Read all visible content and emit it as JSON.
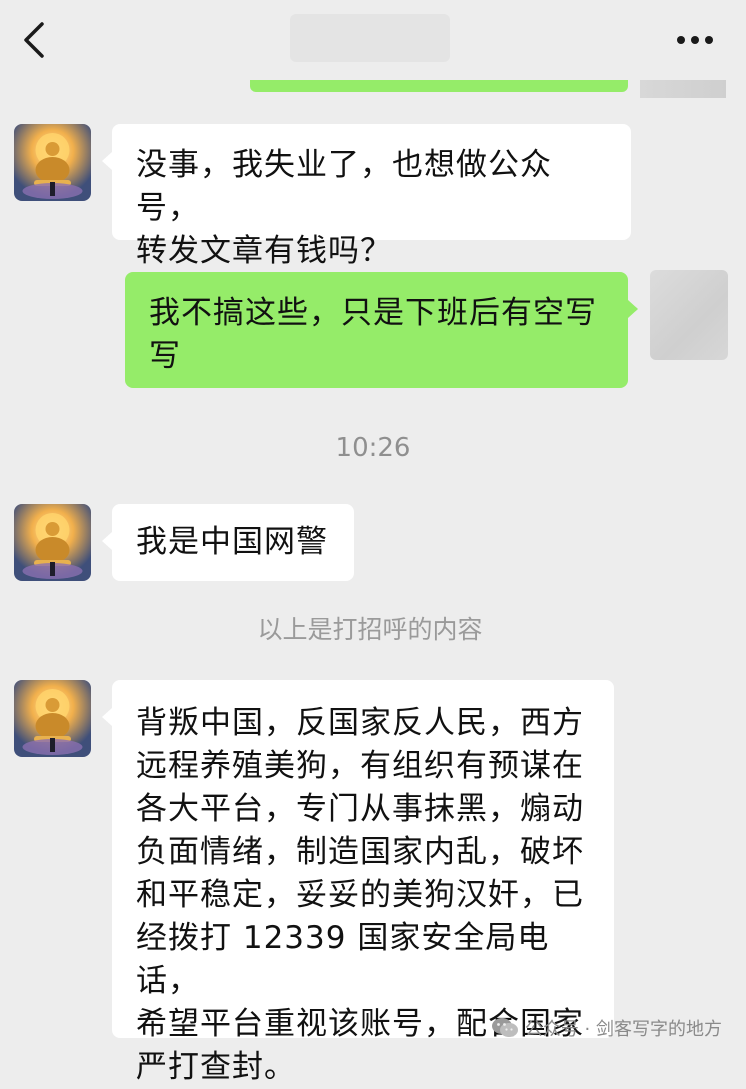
{
  "header": {
    "back_icon": "chevron-left-icon",
    "more_icon": "ellipsis-icon"
  },
  "messages": [
    {
      "side": "left",
      "text": "没事，我失业了，也想做公众号，\n转发文章有钱吗？"
    },
    {
      "side": "right",
      "text": "我不搞这些，只是下班后有空写\n写"
    },
    {
      "side": "left",
      "text": "我是中国网警"
    },
    {
      "side": "left",
      "text": "背叛中国，反国家反人民，西方\n远程养殖美狗，有组织有预谋在\n各大平台，专门从事抹黑，煽动\n负面情绪，制造国家内乱，破坏\n和平稳定，妥妥的美狗汉奸，已\n经拨打 12339 国家安全局电话，\n希望平台重视该账号，配合国家\n严打查封。"
    }
  ],
  "timestamp": "10:26",
  "system_note": "以上是打招呼的内容",
  "watermark": {
    "icon": "wechat-icon",
    "text": "公众号 · 剑客写字的地方"
  },
  "colors": {
    "background": "#ededed",
    "self_bubble": "#95ec69",
    "other_bubble": "#ffffff"
  }
}
